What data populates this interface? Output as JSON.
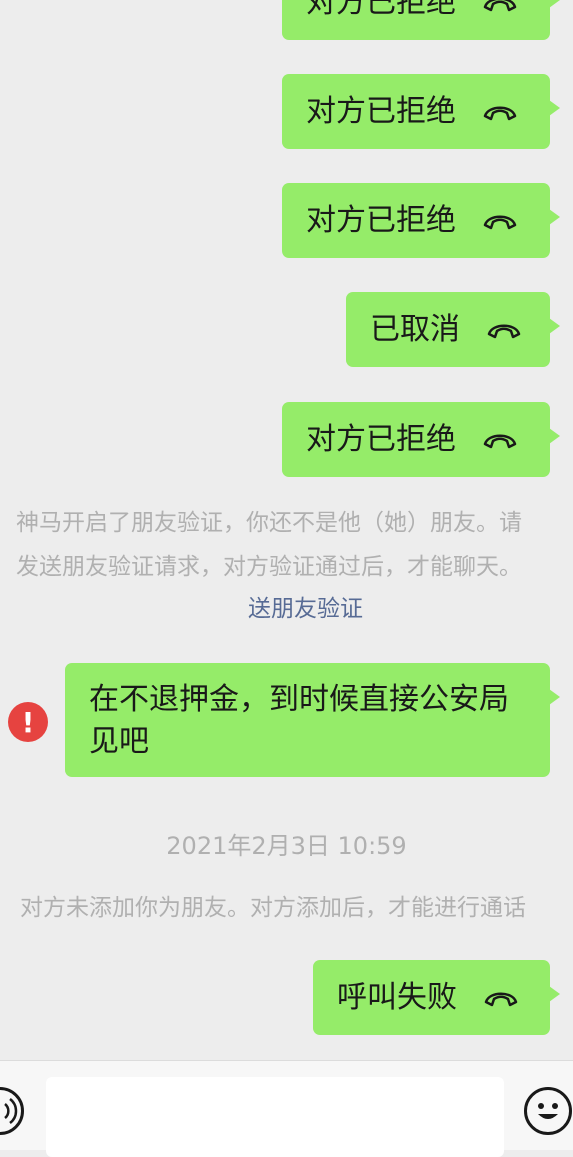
{
  "messages": {
    "m0": {
      "label": "对方已拒绝",
      "icon": "hangup-icon"
    },
    "m1": {
      "label": "对方已拒绝",
      "icon": "hangup-icon"
    },
    "m2": {
      "label": "对方已拒绝",
      "icon": "hangup-icon"
    },
    "m3": {
      "label": "已取消",
      "icon": "hangup-icon"
    },
    "m4": {
      "label": "对方已拒绝",
      "icon": "hangup-icon"
    },
    "m5": {
      "text": "在不退押金，到时候直接公安局见吧",
      "status_icon": "error-icon",
      "status_symbol": "!"
    },
    "m6": {
      "label": "呼叫失败",
      "icon": "hangup-icon"
    }
  },
  "system": {
    "verify_line1": "神马开启了朋友验证，你还不是他（她）朋友。请",
    "verify_line2": "发送朋友验证请求，对方验证通过后，才能聊天。",
    "verify_link": "送朋友验证",
    "not_added": "对方未添加你为朋友。对方添加后，才能进行通话"
  },
  "timestamp": "2021年2月3日 10:59",
  "input_bar": {
    "voice_icon": "voice-icon",
    "emoji_icon": "emoji-icon",
    "input_value": ""
  },
  "colors": {
    "bubble": "#95ec69",
    "background": "#ededed",
    "link": "#576b95",
    "system_text": "#b0b0b0",
    "error": "#e64340"
  }
}
